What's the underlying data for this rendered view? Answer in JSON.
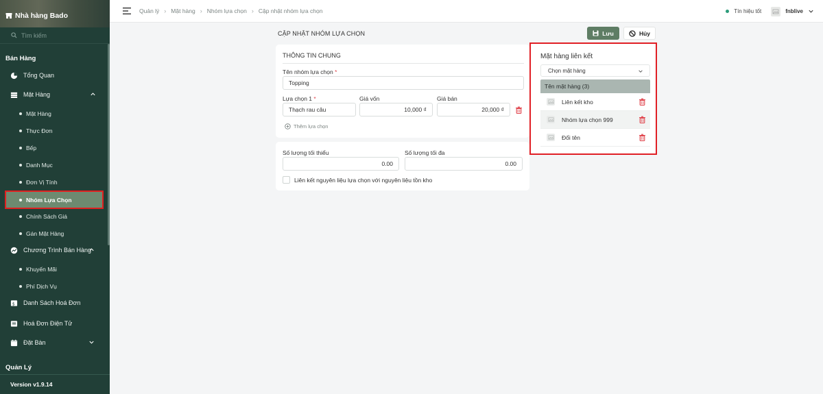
{
  "sidebar": {
    "brand": "Nhà hàng Bado",
    "search_placeholder": "Tìm kiếm",
    "section_sales": "Bán Hàng",
    "items": {
      "overview": "Tổng Quan",
      "products": "Mặt Hàng",
      "sub_products": "Mặt Hàng",
      "sub_menu": "Thực Đơn",
      "sub_kitchen": "Bếp",
      "sub_category": "Danh Mục",
      "sub_unit": "Đơn Vị Tính",
      "sub_option_group": "Nhóm Lựa Chọn",
      "sub_price_policy": "Chính Sách Giá",
      "sub_assign_product": "Gán Mặt Hàng",
      "sales_program": "Chương Trình Bán Hàng",
      "sub_promotion": "Khuyến Mãi",
      "sub_service_fee": "Phí Dịch Vụ",
      "invoice_list": "Danh Sách Hoá Đơn",
      "e_invoice": "Hoá Đơn Điện Tử",
      "reservation": "Đặt Bàn"
    },
    "section_manage": "Quản Lý",
    "version": "Version v1.9.14"
  },
  "topbar": {
    "breadcrumbs": [
      "Quản lý",
      "Mặt hàng",
      "Nhóm lựa chọn",
      "Cập nhật nhóm lựa chọn"
    ],
    "signal": "Tín hiệu tốt",
    "username": "fnblive"
  },
  "page": {
    "title": "CẬP NHẬT NHÓM LỰA CHỌN",
    "save_label": "Lưu",
    "cancel_label": "Hủy"
  },
  "general": {
    "header": "THÔNG TIN CHUNG",
    "group_name_label": "Tên nhóm lựa chọn",
    "group_name_value": "Topping",
    "option_label": "Lựa chọn 1",
    "option_value": "Thạch rau câu",
    "cost_label": "Giá vốn",
    "cost_value": "10,000 ₫",
    "price_label": "Giá bán",
    "price_value": "20,000 ₫",
    "add_option": "Thêm lựa chọn",
    "required_mark": "*"
  },
  "quantity": {
    "min_label": "Số lượng tối thiểu",
    "min_value": "0.00",
    "max_label": "Số lượng tối đa",
    "max_value": "0.00",
    "link_checkbox_label": "Liên kết nguyên liệu lựa chọn với nguyên liệu tồn kho"
  },
  "linked": {
    "title": "Mặt hàng liên kết",
    "select_placeholder": "Chọn mặt hàng",
    "table_header": "Tên mặt hàng (3)",
    "items": [
      "Liên kết kho",
      "Nhóm lựa chọn 999",
      "Đổi tên"
    ]
  },
  "colors": {
    "sidebar_bg": "#213f37",
    "accent_green": "#5e7d64",
    "highlight_red": "#e01e24",
    "delete_red": "#e0464e"
  }
}
